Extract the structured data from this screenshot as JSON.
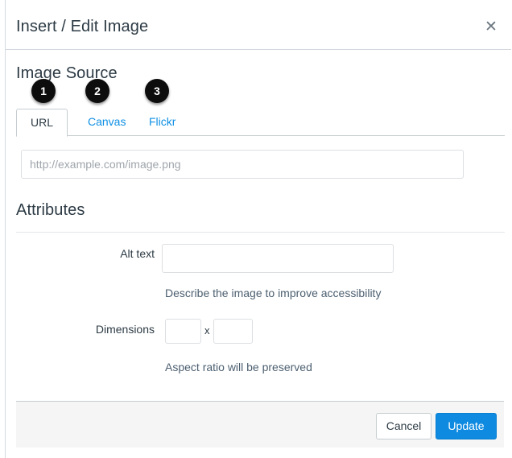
{
  "dialog": {
    "title": "Insert / Edit Image",
    "close_icon": "close-icon",
    "close_glyph": "✕"
  },
  "image_source": {
    "heading": "Image Source",
    "tabs": [
      {
        "label": "URL",
        "active": true,
        "badge": "1"
      },
      {
        "label": "Canvas",
        "active": false,
        "badge": "2"
      },
      {
        "label": "Flickr",
        "active": false,
        "badge": "3"
      }
    ],
    "url_field": {
      "value": "",
      "placeholder": "http://example.com/image.png"
    }
  },
  "attributes": {
    "heading": "Attributes",
    "alt_text": {
      "label": "Alt text",
      "value": "",
      "helper": "Describe the image to improve accessibility"
    },
    "dimensions": {
      "label": "Dimensions",
      "width_value": "",
      "height_value": "",
      "separator": "x",
      "helper": "Aspect ratio will be preserved"
    }
  },
  "footer": {
    "cancel_label": "Cancel",
    "update_label": "Update"
  },
  "colors": {
    "link_blue": "#0e90e4",
    "primary_blue": "#0e8ae0",
    "text_dark": "#2d3b45",
    "helper_text": "#4c5f70",
    "badge_bg": "#0d0d0d",
    "border": "#c7cdd1",
    "footer_bg": "#f5f5f5"
  }
}
